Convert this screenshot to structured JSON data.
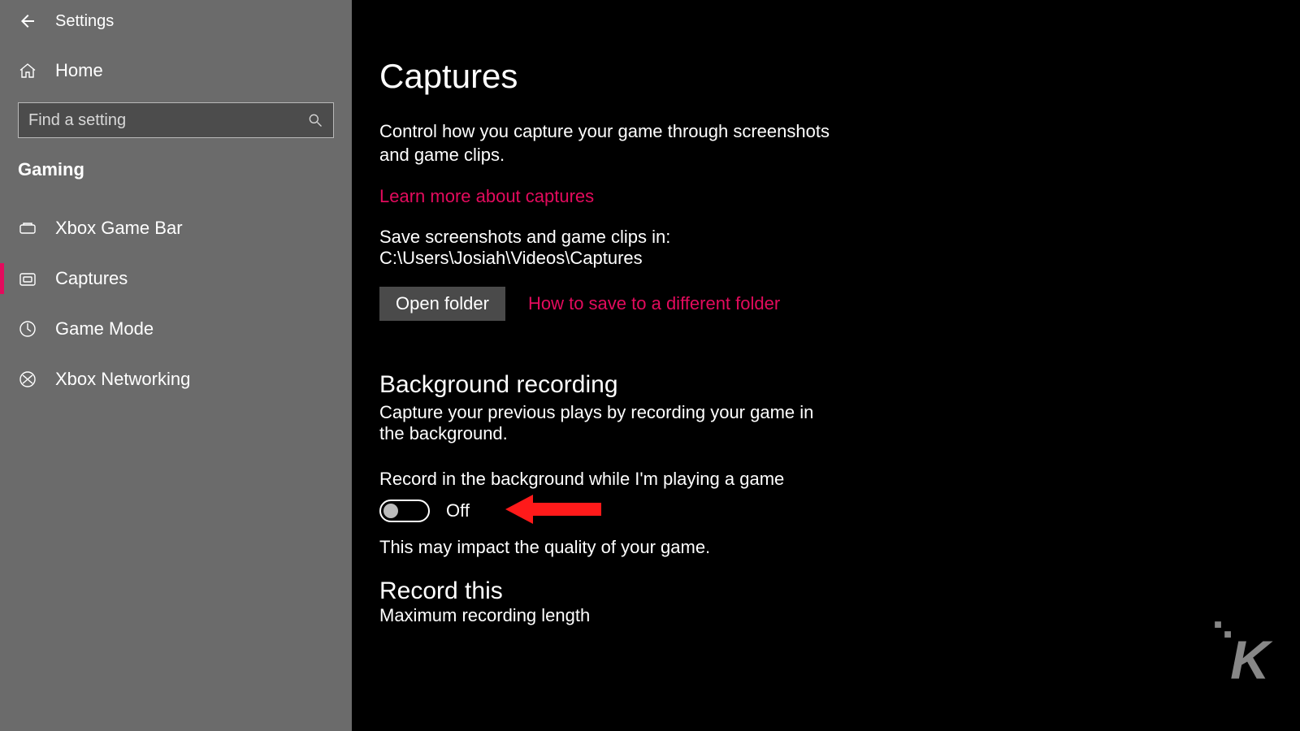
{
  "header": {
    "title": "Settings",
    "home_label": "Home"
  },
  "search": {
    "placeholder": "Find a setting"
  },
  "sidebar": {
    "category": "Gaming",
    "items": [
      {
        "label": "Xbox Game Bar",
        "icon": "gamebar-icon",
        "selected": false
      },
      {
        "label": "Captures",
        "icon": "captures-icon",
        "selected": true
      },
      {
        "label": "Game Mode",
        "icon": "gamemode-icon",
        "selected": false
      },
      {
        "label": "Xbox Networking",
        "icon": "xbox-icon",
        "selected": false
      }
    ]
  },
  "main": {
    "page_title": "Captures",
    "intro": "Control how you capture your game through screenshots and game clips.",
    "learn_more": "Learn more about captures",
    "save_path": "Save screenshots and game clips in: C:\\Users\\Josiah\\Videos\\Captures",
    "open_folder_btn": "Open folder",
    "diff_folder_link": "How to save to a different folder",
    "bg_recording": {
      "title": "Background recording",
      "subtitle": "Capture your previous plays by recording your game in the background.",
      "toggle_label": "Record in the background while I'm playing a game",
      "toggle_state": "Off",
      "note": "This may impact the quality of your game."
    },
    "record_this": {
      "title": "Record this",
      "max_len_label": "Maximum recording length"
    }
  },
  "accent_color": "#e30b5d"
}
